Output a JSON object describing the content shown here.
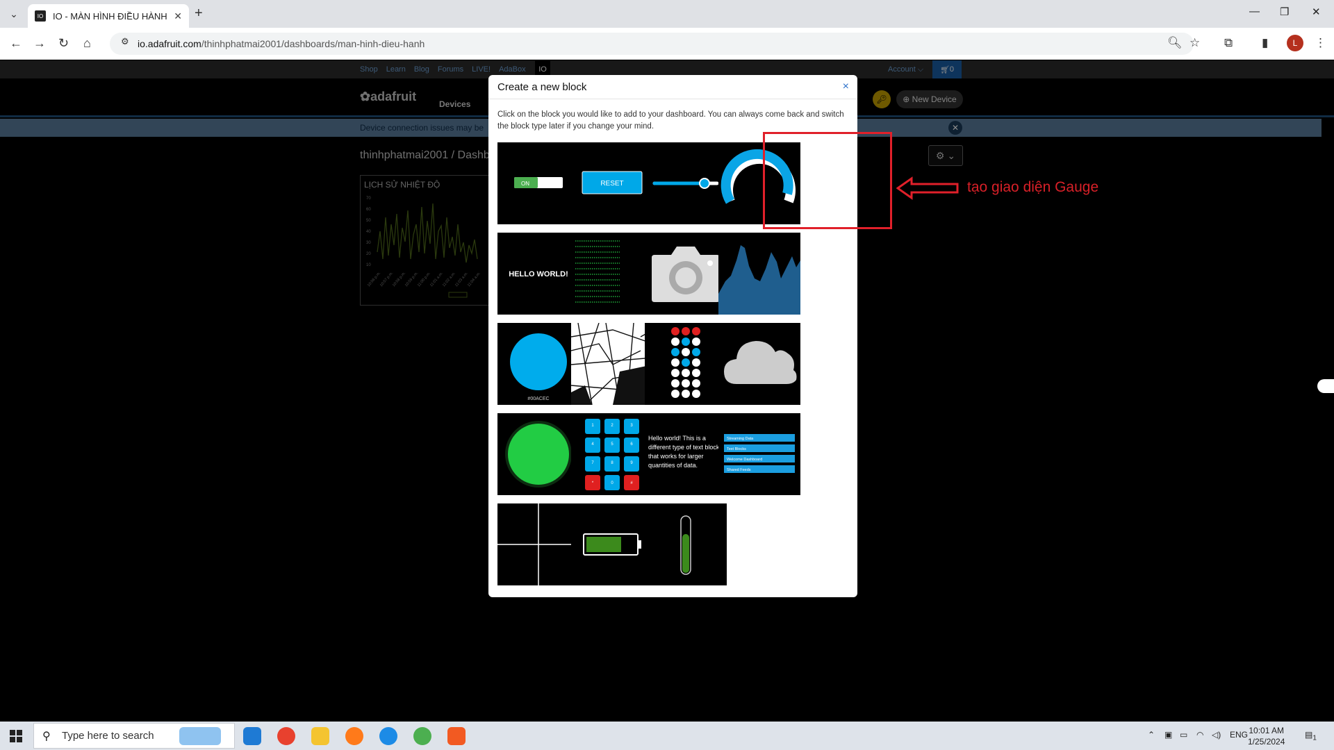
{
  "browser": {
    "tab_title": "IO - MÀN HÌNH ĐIỀU HÀNH",
    "url_host": "io.adafruit.com",
    "url_path": "/thinhphatmai2001/dashboards/man-hinh-dieu-hanh",
    "profile_initial": "L"
  },
  "site": {
    "topnav_links": [
      "Shop",
      "Learn",
      "Blog",
      "Forums",
      "LIVE!",
      "AdaBox"
    ],
    "io_label": "IO",
    "account": "Account ⌵",
    "cart_count": "0",
    "logo": "adafruit",
    "devices": "Devices",
    "new_device": "New Device",
    "banner_text": "Device connection issues may be",
    "breadcrumb": "thinhphatmai2001 / Dashb",
    "chart_card_title": "LỊCH SỬ NHIỆT ĐỘ",
    "chart_card_yticks": [
      "70",
      "60",
      "50",
      "40",
      "30",
      "20",
      "10"
    ],
    "chart_card_xticks": [
      "10:56 p.m.",
      "10:57 p.m.",
      "10:58 p.m.",
      "10:59 p.m.",
      "11:00 p.m.",
      "11:01 a.m.",
      "11:02 a.m.",
      "11:03 a.m.",
      "11:04 a.m."
    ]
  },
  "modal": {
    "title": "Create a new block",
    "close": "×",
    "description": "Click on the block you would like to add to your dashboard. You can always come back and switch the block type later if you change your mind.",
    "tiles": [
      {
        "name": "toggle",
        "label": "ON"
      },
      {
        "name": "momentary-button",
        "label": "RESET"
      },
      {
        "name": "slider",
        "label": ""
      },
      {
        "name": "gauge",
        "label": ""
      },
      {
        "name": "text",
        "label": "HELLO WORLD!"
      },
      {
        "name": "stream",
        "label": ""
      },
      {
        "name": "image",
        "label": ""
      },
      {
        "name": "line-chart",
        "label": ""
      },
      {
        "name": "color-picker",
        "label": "#00ACEC"
      },
      {
        "name": "map",
        "label": ""
      },
      {
        "name": "remote-control",
        "label": ""
      },
      {
        "name": "icon",
        "label": ""
      },
      {
        "name": "indicator",
        "label": ""
      },
      {
        "name": "number-pad",
        "label": ""
      },
      {
        "name": "multiline-text",
        "label": "Hello world! This is a different type of text block that works for larger quantities of data."
      },
      {
        "name": "stream-list",
        "label": ""
      },
      {
        "name": "divider",
        "label": ""
      },
      {
        "name": "battery",
        "label": ""
      },
      {
        "name": "vertical-meter",
        "label": ""
      }
    ],
    "number_pad_keys": [
      "1",
      "2",
      "3",
      "4",
      "5",
      "6",
      "7",
      "8",
      "9",
      "*",
      "0",
      "#"
    ],
    "stream_list_items": [
      "Streaming Data",
      "Text Blocks",
      "Welcome Dashboard",
      "Shared Feeds"
    ]
  },
  "annotation": {
    "text": "tạo giao diện Gauge",
    "color": "#d82028"
  },
  "taskbar": {
    "search_placeholder": "Type here to search",
    "language": "ENG",
    "time": "10:01 AM",
    "date": "1/25/2024",
    "notification_count": "1"
  },
  "colors": {
    "accent_blue": "#00a8e8",
    "gauge_blue": "#0aa5e6",
    "indicator_green": "#22cc44"
  }
}
